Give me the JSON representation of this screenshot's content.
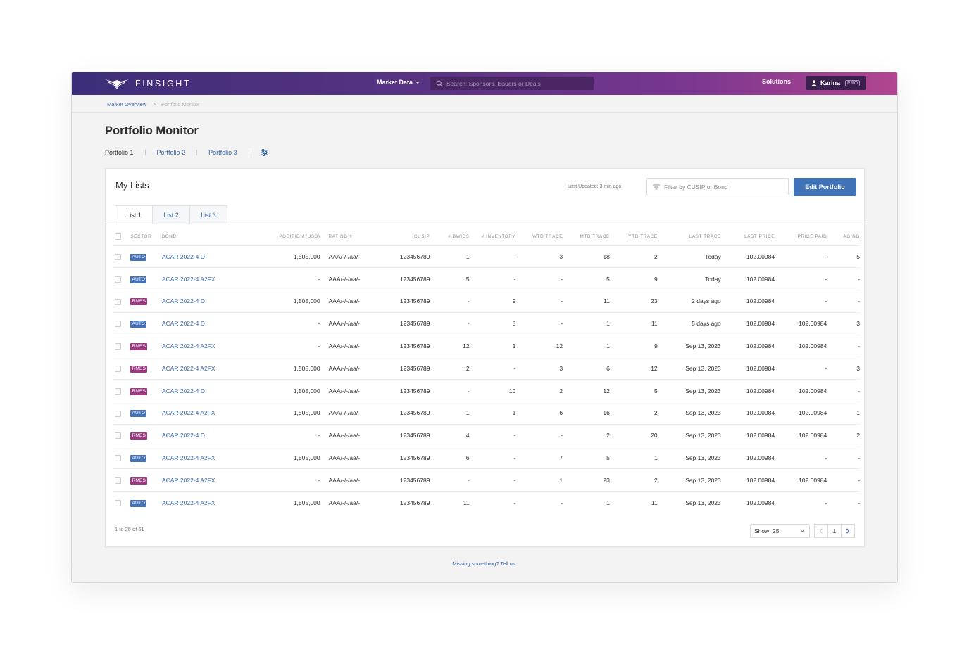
{
  "nav": {
    "logo_text": "FINSIGHT",
    "market_data": "Market Data",
    "search_placeholder": "Search: Sponsors, Issuers or Deals",
    "solutions": "Solutions",
    "user_name": "Karina",
    "user_badge": "PRO"
  },
  "breadcrumb": {
    "root": "Market Overview",
    "separator": ">",
    "current": "Portfolio Monitor"
  },
  "page_title": "Portfolio Monitor",
  "portfolio_tabs": [
    "Portfolio 1",
    "Portfolio 2",
    "Portfolio 3"
  ],
  "active_portfolio": "Portfolio 1",
  "card": {
    "title": "My Lists",
    "last_updated": "Last Updated: 3 min ago",
    "filter_placeholder": "Filter by CUSIP or Bond",
    "edit_button": "Edit Portfolio"
  },
  "list_tabs": [
    "List 1",
    "List 2",
    "List 3"
  ],
  "table": {
    "columns": [
      "SECTOR",
      "BOND",
      "POSITION (USD)",
      "RATING",
      "CUSIP",
      "# BWICS",
      "# INVENTORY",
      "WTD TRACE",
      "MTD TRACE",
      "YTD TRACE",
      "LAST TRACE",
      "LAST PRICE",
      "PRICE PAID",
      "AGING"
    ],
    "rows": [
      [
        "AUTO",
        "ACAR 2022-4 D",
        "1,505,000",
        "AAA/-/-/aa/-",
        "123456789",
        "1",
        "-",
        "3",
        "18",
        "2",
        "Today",
        "102.00984",
        "-",
        "5"
      ],
      [
        "AUTO",
        "ACAR 2022-4 A2FX",
        "-",
        "AAA/-/-/aa/-",
        "123456789",
        "5",
        "-",
        "-",
        "5",
        "9",
        "Today",
        "102.00984",
        "-",
        "-"
      ],
      [
        "RMBS",
        "ACAR 2022-4 D",
        "1,505,000",
        "AAA/-/-/aa/-",
        "123456789",
        "-",
        "9",
        "-",
        "11",
        "23",
        "2 days ago",
        "102.00984",
        "-",
        "-"
      ],
      [
        "AUTO",
        "ACAR 2022-4 D",
        "-",
        "AAA/-/-/aa/-",
        "123456789",
        "-",
        "5",
        "-",
        "1",
        "11",
        "5 days ago",
        "102.00984",
        "102.00984",
        "3"
      ],
      [
        "RMBS",
        "ACAR 2022-4 A2FX",
        "-",
        "AAA/-/-/aa/-",
        "123456789",
        "12",
        "1",
        "12",
        "1",
        "9",
        "Sep 13, 2023",
        "102.00984",
        "102.00984",
        "-"
      ],
      [
        "RMBS",
        "ACAR 2022-4 A2FX",
        "1,505,000",
        "AAA/-/-/aa/-",
        "123456789",
        "2",
        "-",
        "3",
        "6",
        "12",
        "Sep 13, 2023",
        "102.00984",
        "-",
        "3"
      ],
      [
        "RMBS",
        "ACAR 2022-4 D",
        "1,505,000",
        "AAA/-/-/aa/-",
        "123456789",
        "-",
        "10",
        "2",
        "12",
        "5",
        "Sep 13, 2023",
        "102.00984",
        "102.00984",
        "-"
      ],
      [
        "AUTO",
        "ACAR 2022-4 A2FX",
        "1,505,000",
        "AAA/-/-/aa/-",
        "123456789",
        "1",
        "1",
        "6",
        "16",
        "2",
        "Sep 13, 2023",
        "102.00984",
        "102.00984",
        "1"
      ],
      [
        "RMBS",
        "ACAR 2022-4 D",
        "-",
        "AAA/-/-/aa/-",
        "123456789",
        "4",
        "-",
        "-",
        "2",
        "20",
        "Sep 13, 2023",
        "102.00984",
        "102.00984",
        "2"
      ],
      [
        "AUTO",
        "ACAR 2022-4 A2FX",
        "1,505,000",
        "AAA/-/-/aa/-",
        "123456789",
        "6",
        "-",
        "7",
        "5",
        "1",
        "Sep 13, 2023",
        "102.00984",
        "-",
        "-"
      ],
      [
        "RMBS",
        "ACAR 2022-4 A2FX",
        "-",
        "AAA/-/-/aa/-",
        "123456789",
        "-",
        "-",
        "1",
        "23",
        "2",
        "Sep 13, 2023",
        "102.00984",
        "102.00984",
        "-"
      ],
      [
        "AUTO",
        "ACAR 2022-4 A2FX",
        "1,505,000",
        "AAA/-/-/aa/-",
        "123456789",
        "11",
        "-",
        "-",
        "1",
        "11",
        "Sep 13, 2023",
        "102.00984",
        "-",
        "-"
      ]
    ]
  },
  "footer": {
    "count": "1 to 25 of 61",
    "show": "Show: 25",
    "page": "1",
    "missing": "Missing something? Tell us."
  },
  "colors": {
    "accent": "#3f72b6",
    "auto_tag": "#4471b8",
    "rmbs_tag": "#9c3b83",
    "header_start": "#3d2d78",
    "header_end": "#b2458f"
  },
  "icons": [
    "logo-wings-icon",
    "chevron-down-icon",
    "search-icon",
    "user-icon",
    "sliders-icon",
    "filter-icon",
    "chevron-left-icon",
    "chevron-right-icon"
  ]
}
